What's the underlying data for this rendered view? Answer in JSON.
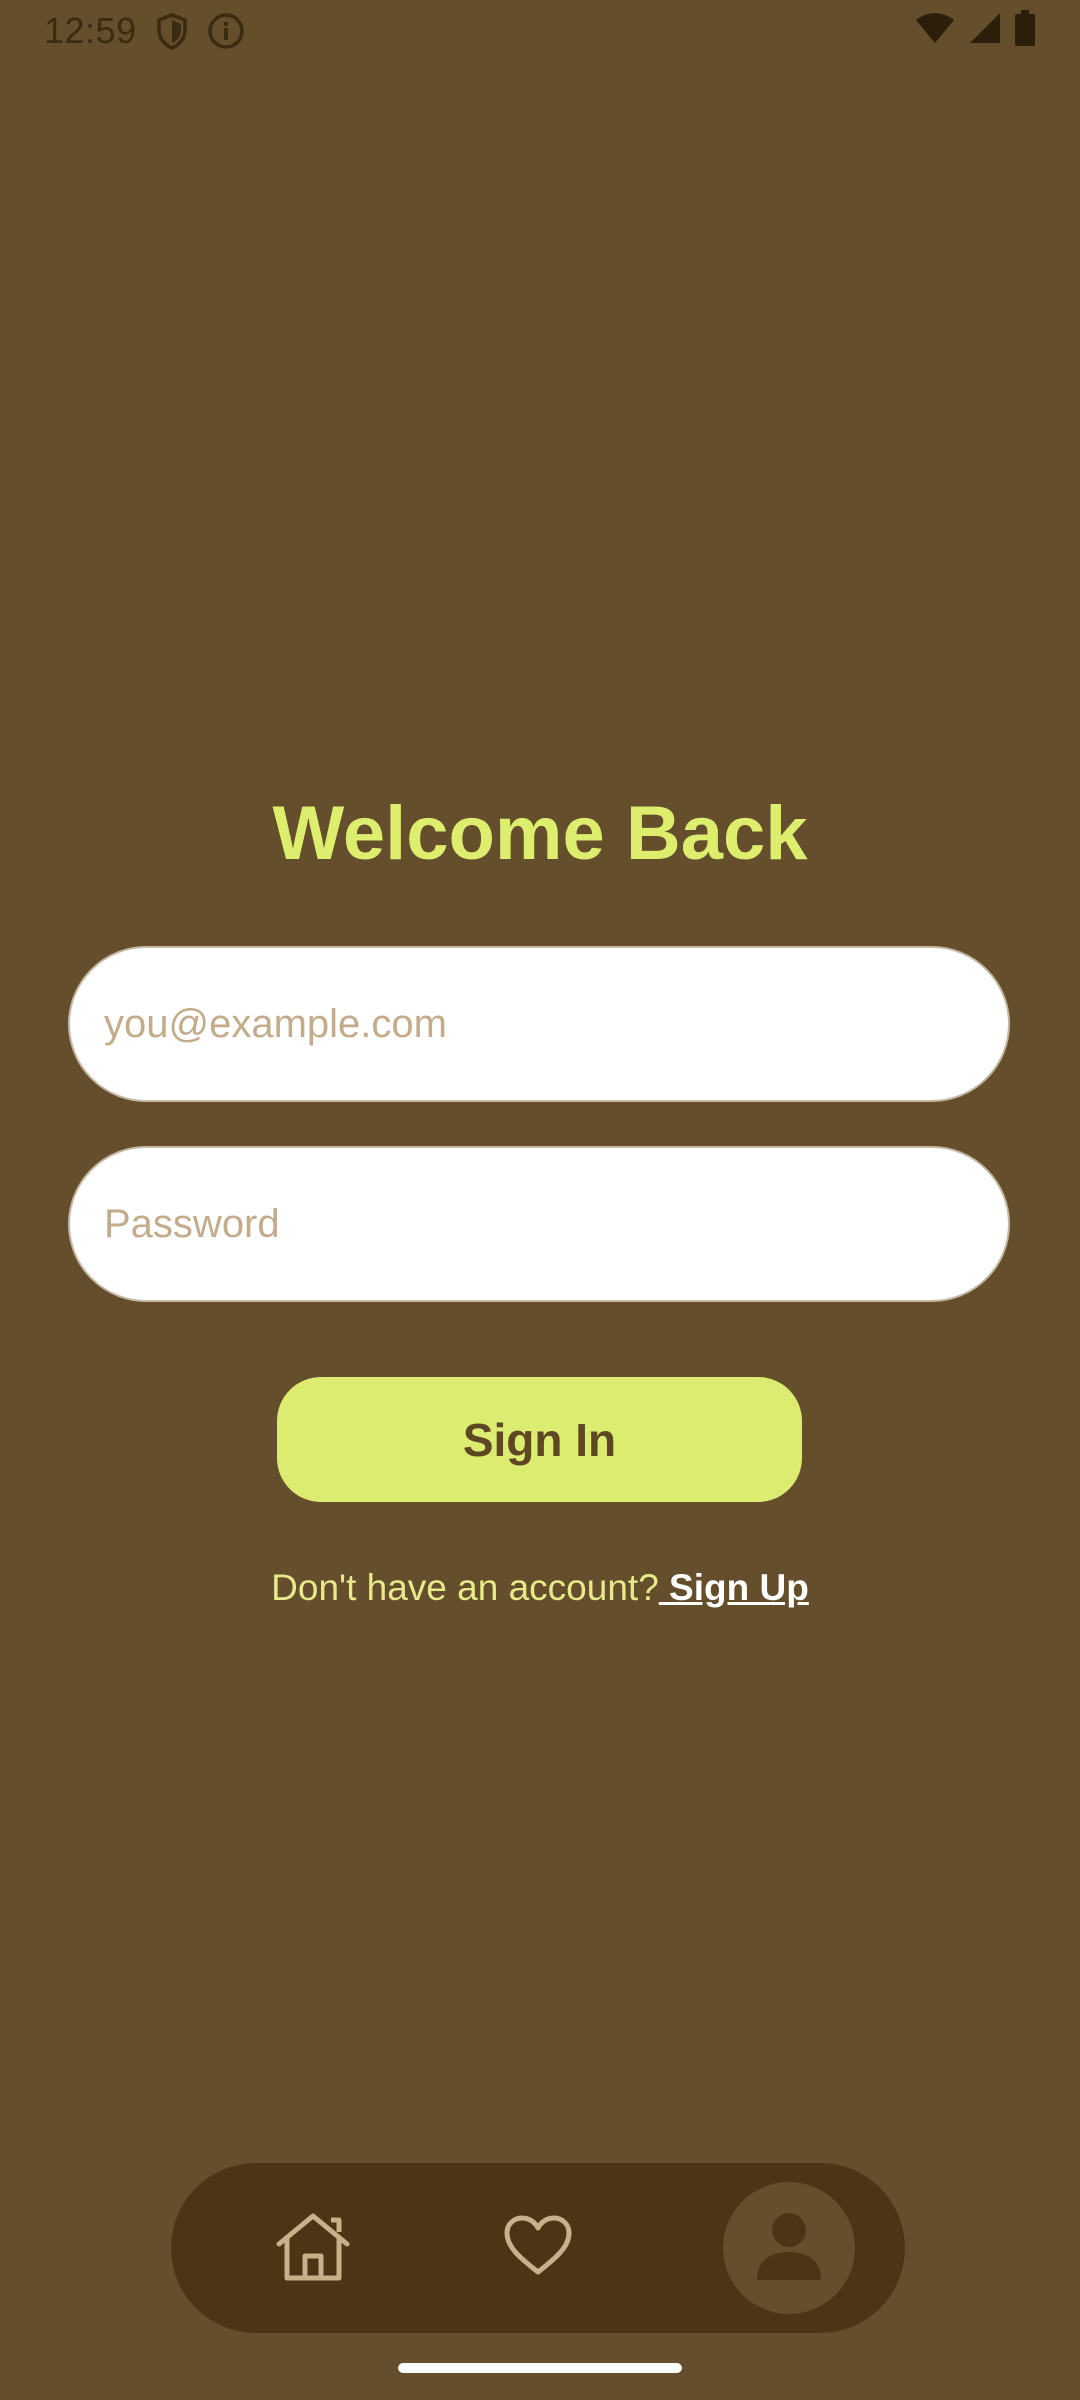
{
  "status_bar": {
    "time": "12:59",
    "left_icons": [
      "shield-icon",
      "info-icon"
    ],
    "right_icons": [
      "wifi-icon",
      "signal-icon",
      "battery-icon"
    ]
  },
  "login": {
    "title": "Welcome Back",
    "email_placeholder": "you@example.com",
    "email_value": "",
    "password_placeholder": "Password",
    "password_value": "",
    "signin_label": "Sign In",
    "signup_prompt": "Don't have an account?",
    "signup_link": " Sign Up"
  },
  "bottom_nav": {
    "items": [
      {
        "icon": "home-icon",
        "active": false
      },
      {
        "icon": "heart-icon",
        "active": false
      },
      {
        "icon": "profile-icon",
        "active": true
      }
    ]
  },
  "colors": {
    "background": "#644e2b",
    "accent": "#dcec70",
    "title": "#dded6d",
    "nav_background": "#4b3514",
    "placeholder": "#c3ac8c"
  }
}
